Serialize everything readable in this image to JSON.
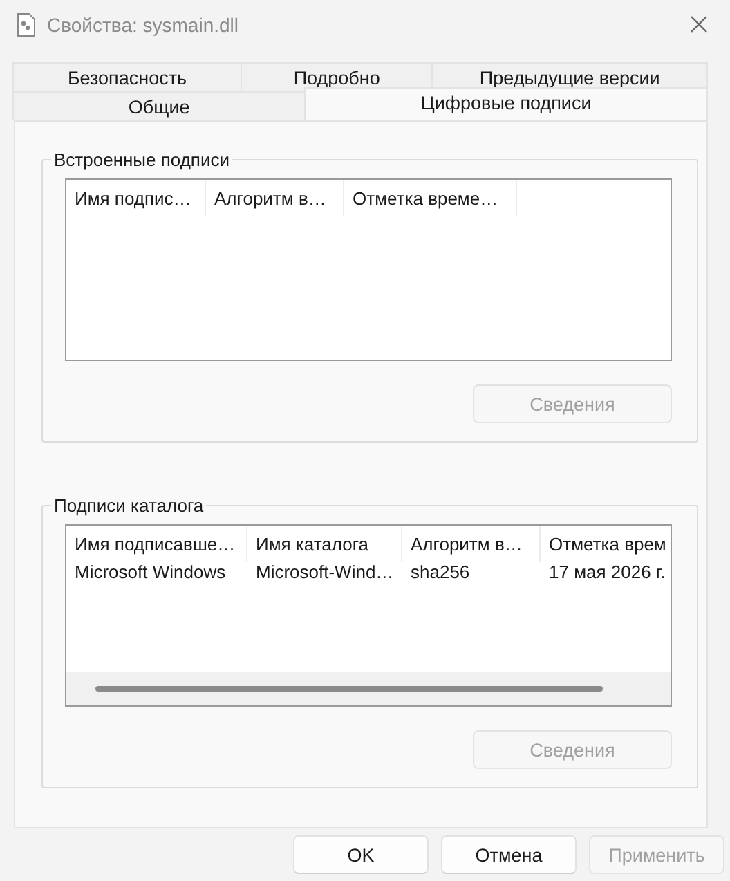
{
  "window": {
    "title": "Свойства: sysmain.dll"
  },
  "tab_rows": [
    [
      {
        "label": "Безопасность",
        "selected": false
      },
      {
        "label": "Подробно",
        "selected": false
      },
      {
        "label": "Предыдущие версии",
        "selected": false
      }
    ],
    [
      {
        "label": "Общие",
        "selected": false
      },
      {
        "label": "Цифровые подписи",
        "selected": true
      }
    ]
  ],
  "embedded_signatures": {
    "title": "Встроенные подписи",
    "columns": [
      "Имя подпис…",
      "Алгоритм в…",
      "Отметка време…"
    ],
    "details_button": {
      "label": "Сведения",
      "disabled": true
    }
  },
  "catalog_signatures": {
    "title": "Подписи каталога",
    "columns": [
      "Имя подписавше…",
      "Имя каталога",
      "Алгоритм в…",
      "Отметка врем"
    ],
    "rows": [
      [
        "Microsoft Windows",
        "Microsoft-Wind…",
        "sha256",
        "17 мая 2026 г."
      ]
    ],
    "details_button": {
      "label": "Сведения",
      "disabled": true
    }
  },
  "buttons": [
    {
      "label": "OK",
      "disabled": false
    },
    {
      "label": "Отмена",
      "disabled": false
    },
    {
      "label": "Применить",
      "disabled": true
    }
  ]
}
